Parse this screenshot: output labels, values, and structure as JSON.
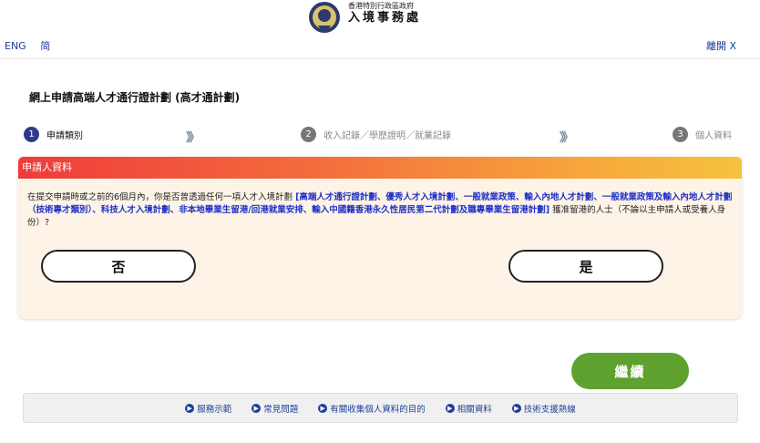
{
  "header": {
    "org_name_small": "香港特別行政區政府",
    "org_name_big": "入境事務處",
    "lang_eng": "ENG",
    "lang_simplified": "简",
    "leave": "離開 X"
  },
  "page_title": "網上申請高端人才通行證計劃 (高才通計劃)",
  "steps": [
    {
      "number": "1",
      "label": "申請類別",
      "active": true
    },
    {
      "number": "2",
      "label": "收入記錄／學歷證明／就業記錄",
      "active": false
    },
    {
      "number": "3",
      "label": "個人資料",
      "active": false
    }
  ],
  "step_separator": "》》",
  "panel": {
    "title": "申請人資料",
    "question_prefix": "在提交申請時或之前的6個月內，你是否曾透過任何一項人才入境計劃 ",
    "question_highlight": "[高端人才通行證計劃、優秀人才入境計劃、一般就業政策、輸入內地人才計劃、一般就業政策及輸入內地人才計劃（技術專才類別）、科技人才入境計劃、非本地畢業生留港/回港就業安排、輸入中國籍香港永久性居民第二代計劃及職專畢業生留港計劃]",
    "question_suffix": " 獲准留港的人士（不論以主申請人或受養人身份）?",
    "no_label": "否",
    "yes_label": "是"
  },
  "continue_label": "繼續",
  "footer": {
    "links": [
      "服務示範",
      "常見問題",
      "有關收集個人資料的目的",
      "相關資料",
      "技術支援熱線"
    ]
  },
  "colors": {
    "primary_blue": "#1d3f9a",
    "continue_green": "#5fa12e",
    "panel_bg": "#fdf3e7"
  }
}
